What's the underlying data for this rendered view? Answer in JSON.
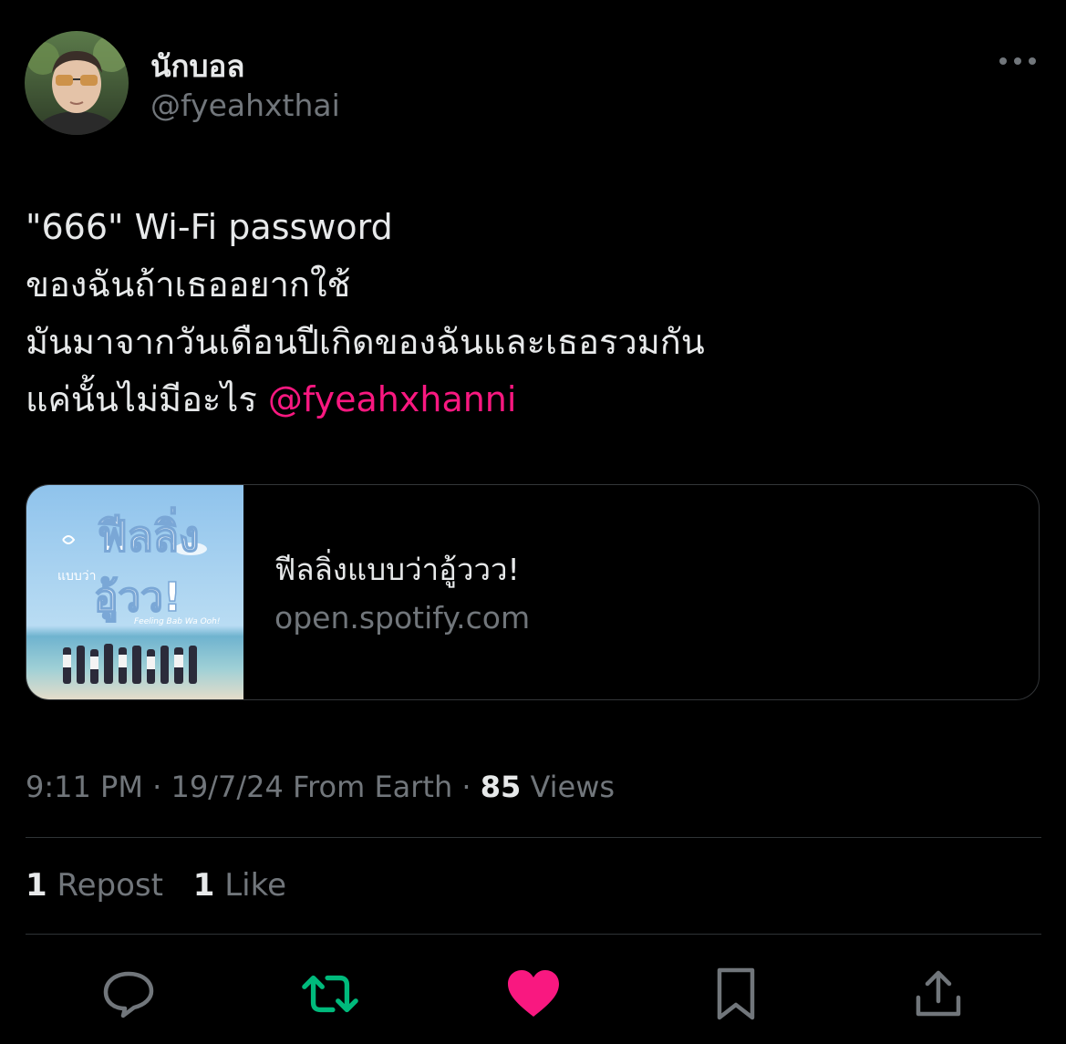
{
  "author": {
    "display_name": "นักบอล",
    "handle": "@fyeahxthai"
  },
  "tweet": {
    "lines": [
      "\"666\" Wi-Fi password",
      "ของฉันถ้าเธออยากใช้",
      "มันมาจากวันเดือนปีเกิดของฉันและเธอรวมกัน",
      "แค่นั้นไม่มีอะไร"
    ],
    "mention": "@fyeahxhanni"
  },
  "card": {
    "title": "ฟีลลิ่งแบบว่าอู้ววว!",
    "domain": "open.spotify.com",
    "thumb_title": "ฟีลลิ่ง",
    "thumb_subtitle": "แบบว่า",
    "thumb_big": "อู้วว!",
    "thumb_english": "Feeling Bab Wa Ooh!"
  },
  "meta": {
    "time": "9:11 PM",
    "date": "19/7/24",
    "location": "From Earth",
    "views_count": "85",
    "views_label": "Views",
    "separator": "·"
  },
  "stats": {
    "reposts_count": "1",
    "reposts_label": "Repost",
    "likes_count": "1",
    "likes_label": "Like"
  },
  "actions": [
    {
      "icon": "reply-icon"
    },
    {
      "icon": "retweet-icon",
      "active_color": "#00ba7c"
    },
    {
      "icon": "heart-icon",
      "active_color": "#f91880"
    },
    {
      "icon": "bookmark-icon"
    },
    {
      "icon": "share-icon"
    }
  ],
  "colors": {
    "background": "#000000",
    "text": "#e7e9ea",
    "secondary": "#71767b",
    "mention": "#f91880",
    "repost_active": "#00ba7c",
    "like_active": "#f91880",
    "divider": "#2f3336"
  }
}
